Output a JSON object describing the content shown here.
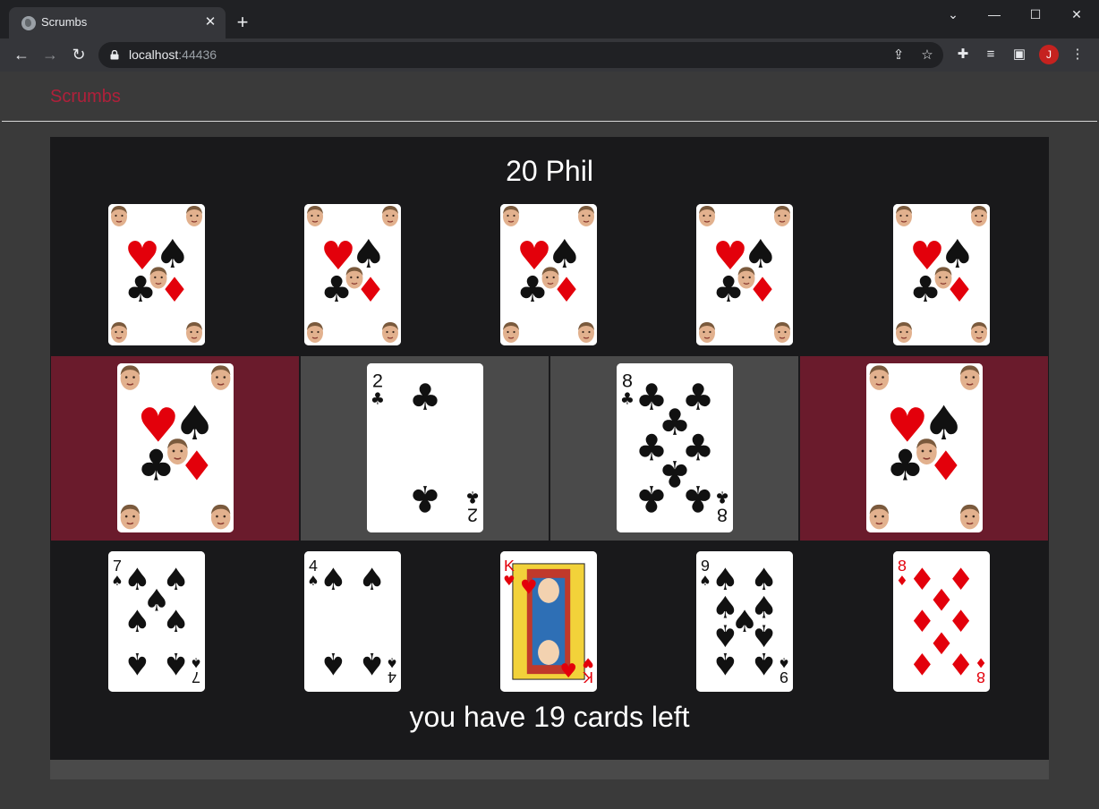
{
  "browser": {
    "tab_title": "Scrumbs",
    "url_host": "localhost",
    "url_port": ":44436",
    "profile_initial": "J"
  },
  "app": {
    "brand": "Scrumbs"
  },
  "game": {
    "opponent_label": "20 Phil",
    "cards_left_label": "you have 19 cards left",
    "opponent_hand_count": 5,
    "table": [
      {
        "type": "back",
        "slot": "red"
      },
      {
        "type": "face",
        "rank": "2",
        "suit": "clubs",
        "slot": "grey"
      },
      {
        "type": "face",
        "rank": "8",
        "suit": "clubs",
        "slot": "grey"
      },
      {
        "type": "back",
        "slot": "red"
      }
    ],
    "hand": [
      {
        "rank": "7",
        "suit": "spades"
      },
      {
        "rank": "4",
        "suit": "spades"
      },
      {
        "rank": "K",
        "suit": "hearts"
      },
      {
        "rank": "9",
        "suit": "spades"
      },
      {
        "rank": "8",
        "suit": "diamonds"
      }
    ]
  },
  "colors": {
    "brand": "#b0203a",
    "slot_red": "#6a1b2c",
    "slot_grey": "#4a4a4a",
    "suit_red": "#e3000b",
    "suit_black": "#111111"
  },
  "icons": {
    "back": "arrow-left-icon",
    "forward": "arrow-right-icon",
    "reload": "reload-icon",
    "lock": "lock-icon",
    "share": "share-icon",
    "bookmark": "star-icon",
    "extensions": "puzzle-icon",
    "media": "media-icon",
    "sidepanel": "side-panel-icon",
    "menu": "kebab-menu-icon"
  }
}
